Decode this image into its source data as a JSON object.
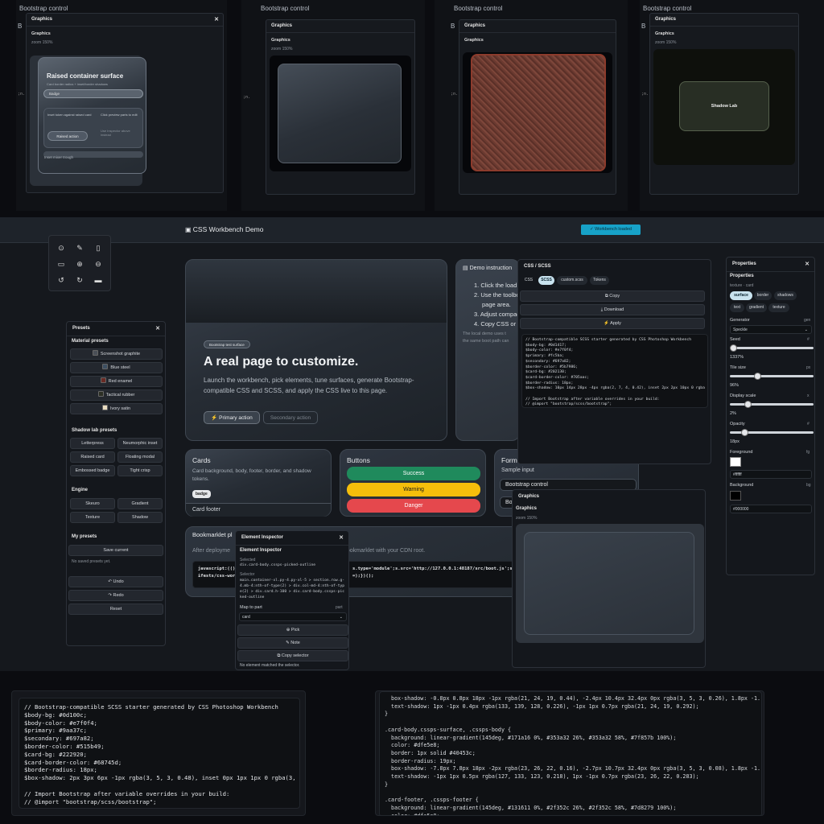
{
  "thumbs": {
    "t1": {
      "bar": "Bootstrap control",
      "b_letter": "B",
      "panel_title": "Graphics",
      "panel_sub": "Graphics",
      "zoom": "zoom 150%",
      "card_title": "Raised container surface",
      "card_sub": "Card border radius + inset/border shadows",
      "badge": "Badge",
      "inset_text": "Inset token against raised card",
      "side_text1": "Click preview parts to edit",
      "side_text2": "Use Inspector above instead",
      "raised_action": "Raised action",
      "trough": "Inset mixer trough",
      "side_code": ";n."
    },
    "t2": {
      "bar": "Bootstrap control",
      "b_letter": "B",
      "panel_title": "Graphics",
      "panel_sub": "Graphics",
      "zoom": "zoom 150%",
      "side_code": ";n."
    },
    "t3": {
      "bar": "Bootstrap control",
      "b_letter": "B",
      "panel_title": "Graphics",
      "panel_sub": "Graphics",
      "zoom": "zoom 150%",
      "side_code": ";n."
    },
    "t4": {
      "bar": "Bootstrap control",
      "b_letter": "B",
      "panel_title": "Graphics",
      "panel_sub": "Graphics",
      "zoom": "zoom 150%",
      "lab_label": "Shadow Lab",
      "side_code": ";n."
    }
  },
  "header": {
    "title": "CSS Workbench Demo",
    "badge": "✓ Workbench loaded"
  },
  "toolbox": {
    "icons": [
      "target-icon",
      "brush-icon",
      "clipboard-icon",
      "document-icon",
      "zoom-in-icon",
      "zoom-out-icon",
      "undo-icon",
      "redo-icon",
      "frame-icon"
    ]
  },
  "hero": {
    "badge": "Bootstrap test surface",
    "title": "A real page to customize.",
    "body": "Launch the workbench, pick elements, tune surfaces, generate Bootstrap-compatible CSS and SCSS, and apply the CSS live to this page.",
    "primary": "Primary action",
    "secondary": "Secondary action"
  },
  "demo": {
    "title": "Demo instruction",
    "steps": [
      "1. Click the load bu",
      "2. Use the toolbox",
      "page area.",
      "3. Adjust compact p",
      "4. Copy CSS or SCS"
    ],
    "note1": "The local demo uses t",
    "note2": "the same boot path can"
  },
  "cards_block": {
    "title": "Cards",
    "body": "Card background, body, footer, border, and shadow tokens.",
    "badge": "badge",
    "footer": "Card footer"
  },
  "buttons_block": {
    "title": "Buttons",
    "success": "Success",
    "warning": "Warning",
    "danger": "Danger"
  },
  "forms_block": {
    "title": "Form",
    "label": "Sample input",
    "input": "Bootstrap control",
    "input2": "Boo"
  },
  "bookmarklet": {
    "title": "Bookmarklet pl",
    "text_left": "After deployme",
    "text_right": "bookmarklet with your CDN root.",
    "code_left": "javascript:(()",
    "code_left2": "ifests/css-wor",
    "code_right": "s.type='module';s.src='http://127.0.0.1:48187/src/boot.js';s.",
    "code_right2": "=);})();"
  },
  "presets": {
    "title": "Presets",
    "material_title": "Material presets",
    "material": [
      {
        "label": "Screenshot graphite",
        "color": "#4a4f57"
      },
      {
        "label": "Blue steel",
        "color": "#3d4f62"
      },
      {
        "label": "Red enamel",
        "color": "#6a2a24"
      },
      {
        "label": "Tactical rubber",
        "color": "#2c2f25"
      },
      {
        "label": "Ivory satin",
        "color": "#e8dcc0"
      }
    ],
    "shadow_title": "Shadow lab presets",
    "shadow": [
      "Letterpress",
      "Neumorphic inset",
      "Raised card",
      "Floating modal",
      "Embossed badge",
      "Tight crisp"
    ],
    "engine_title": "Engine",
    "engine": [
      "Skeuro",
      "Gradient",
      "Texture",
      "Shadow"
    ],
    "my_title": "My presets",
    "save": "Save current",
    "none": "No saved presets yet.",
    "undo": "↶ Undo",
    "redo": "↷ Redo",
    "reset": "Reset"
  },
  "inspector": {
    "title": "Element Inspector",
    "sub": "Element Inspector",
    "selected_label": "Selected",
    "selected": "div.card-body.cssps-picked-outline",
    "selector_label": "Selector",
    "selector": "main.container-xl.py-4.py-xl-5 > section.row.g-4.mb-4:nth-of-type(2) > div.col-md-4:nth-of-type(2) > div.card.h-100 > div.card-body.cssps-picked-outline",
    "map_label": "Map to part",
    "map_right": "part",
    "map_value": "card",
    "pick": "⊕ Pick",
    "note": "✎ Note",
    "copy": "⧉ Copy selector",
    "status": "No element matched the selector."
  },
  "css_panel": {
    "title": "CSS / SCSS",
    "tabs": [
      "CSS",
      "SCSS",
      "custom.scss",
      "Tokens"
    ],
    "copy": "⧉ Copy",
    "download": "⤓ Download",
    "apply": "⚡ Apply",
    "code": "// Bootstrap-compatible SCSS starter generated by CSS Photoshop Workbench\n$body-bg: #0d1417;\n$body-color: #e7f0f4;\n$primary: #fc5ba;\n$secondary: #697a82;\n$border-color: #5b7986;\n$card-bg: #202130;\n$card-border-color: #705aac;\n$border-radius: 18px;\n$box-shadow: 10px 14px 28px -4px rgba(2, 7, 4, 0.42), inset 2px 2px 10px 0 rgba\n\n// Import Bootstrap after variable overrides in your build:\n// @import \"bootstrap/scss/bootstrap\";"
  },
  "props": {
    "title": "Properties",
    "sub": "Properties",
    "texture_label": "texture · card",
    "tabs": [
      "surface",
      "border",
      "shadows",
      "text",
      "gradient",
      "texture"
    ],
    "generator_label": "Generator",
    "generator_right": "gen",
    "generator": "Speckle",
    "seed_label": "Seed",
    "seed": "1337%",
    "tile_label": "Tile size",
    "tile_unit": "px",
    "tile": "96%",
    "scale_label": "Display scale",
    "scale": "2%",
    "opacity_label": "Opacity",
    "opacity": "18px",
    "fg_label": "Foreground",
    "fg_right": "fg",
    "fg_color": "#ffffff",
    "fg_value": "#ffffff",
    "bg_label": "Background",
    "bg_right": "bg",
    "bg_color": "#000000",
    "bg_value": "#000000",
    "seed_right": "#",
    "opacity_right": "#",
    "scale_right": "x"
  },
  "graphics_overlay": {
    "title": "Graphics",
    "sub": "Graphics",
    "zoom": "zoom 150%"
  },
  "bottom_left_code": "// Bootstrap-compatible SCSS starter generated by CSS Photoshop Workbench\n$body-bg: #0d100c;\n$body-color: #e7f0f4;\n$primary: #9aa37c;\n$secondary: #697a82;\n$border-color: #515b49;\n$card-bg: #222920;\n$card-border-color: #68745d;\n$border-radius: 18px;\n$box-shadow: 2px 3px 6px -1px rgba(3, 5, 3, 0.48), inset 0px 1px 1px 0 rgba(3,\n\n// Import Bootstrap after variable overrides in your build:\n// @import \"bootstrap/scss/bootstrap\";",
  "bottom_right_code": "  box-shadow: -0.8px 0.8px 18px -1px rgba(21, 24, 19, 0.44), -2.4px 10.4px 32.4px 0px rgba(3, 5, 3, 0.26), 1.8px -1.\n  text-shadow: 1px -1px 0.4px rgba(133, 139, 128, 0.226), -1px 1px 0.7px rgba(21, 24, 19, 0.292);\n}\n\n.card-body.cssps-surface, .cssps-body {\n  background: linear-gradient(145deg, #171a16 0%, #353a32 26%, #353a32 58%, #7f857b 100%);\n  color: #dfe5e8;\n  border: 1px solid #40453c;\n  border-radius: 19px;\n  box-shadow: -7.8px 7.8px 18px -2px rgba(23, 26, 22, 0.16), -2.7px 10.7px 32.4px 0px rgba(3, 5, 3, 0.08), 1.8px -1.\n  text-shadow: -1px 1px 0.5px rgba(127, 133, 123, 0.218), 1px -1px 0.7px rgba(23, 26, 22, 0.283);\n}\n\n.card-footer, .cssps-footer {\n  background: linear-gradient(145deg, #131611 0%, #2f352c 26%, #2f352c 58%, #7d8279 100%);\n  color: #dfe5e8;"
}
